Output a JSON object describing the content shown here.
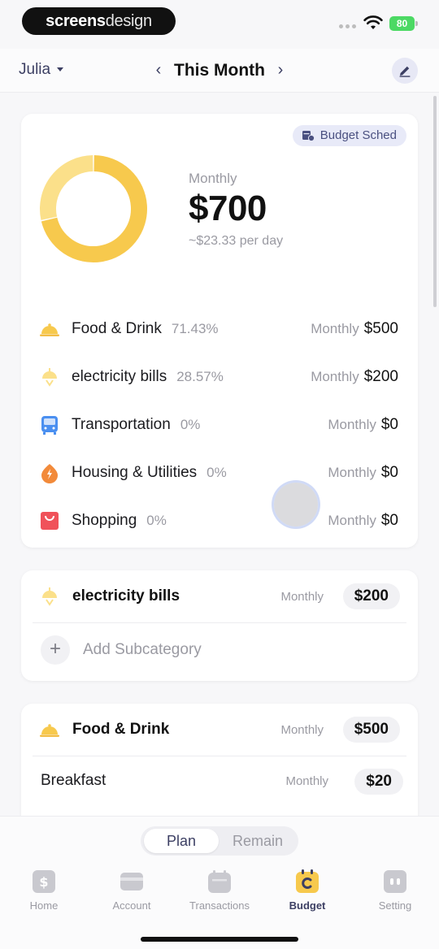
{
  "status_bar": {
    "brand_part1": "screens",
    "brand_part2": "design",
    "battery": "80"
  },
  "header": {
    "user": "Julia",
    "period_title": "This Month",
    "prev_icon": "chevron-left-icon",
    "next_icon": "chevron-right-icon",
    "edit_icon": "pencil-icon"
  },
  "summary": {
    "schedule_pill": "Budget Sched",
    "label": "Monthly",
    "amount": "$700",
    "per_day": "~$23.33 per day",
    "donut_shares": [
      71.43,
      28.57
    ],
    "donut_colors": [
      "#f7c94d",
      "#fbe08a"
    ]
  },
  "categories": [
    {
      "name": "Food & Drink",
      "percent": "71.43%",
      "period": "Monthly",
      "amount": "$500",
      "icon": "cloche-icon",
      "color": "#f7c94d"
    },
    {
      "name": "electricity bills",
      "percent": "28.57%",
      "period": "Monthly",
      "amount": "$200",
      "icon": "lamp-icon",
      "color": "#fbe08a"
    },
    {
      "name": "Transportation",
      "percent": "0%",
      "period": "Monthly",
      "amount": "$0",
      "icon": "bus-icon",
      "color": "#4a8ff0"
    },
    {
      "name": "Housing & Utilities",
      "percent": "0%",
      "period": "Monthly",
      "amount": "$0",
      "icon": "flame-icon",
      "color": "#f28a3a"
    },
    {
      "name": "Shopping",
      "percent": "0%",
      "period": "Monthly",
      "amount": "$0",
      "icon": "shopping-bag-icon",
      "color": "#f0525a"
    }
  ],
  "detail_electricity": {
    "name": "electricity bills",
    "period": "Monthly",
    "amount": "$200",
    "add_label": "Add Subcategory"
  },
  "detail_food": {
    "name": "Food & Drink",
    "period": "Monthly",
    "amount": "$500",
    "sub_name": "Breakfast",
    "sub_period": "Monthly",
    "sub_amount": "$20"
  },
  "segment": {
    "plan": "Plan",
    "remain": "Remain",
    "selected": "Plan"
  },
  "tabs": [
    {
      "label": "Home",
      "icon": "dollar-icon"
    },
    {
      "label": "Account",
      "icon": "card-icon"
    },
    {
      "label": "Transactions",
      "icon": "calendar-icon"
    },
    {
      "label": "Budget",
      "icon": "budget-icon",
      "active": true
    },
    {
      "label": "Setting",
      "icon": "settings-icon"
    }
  ],
  "colors": {
    "accent": "#3c3f63",
    "budget_yellow": "#f7c94d"
  }
}
